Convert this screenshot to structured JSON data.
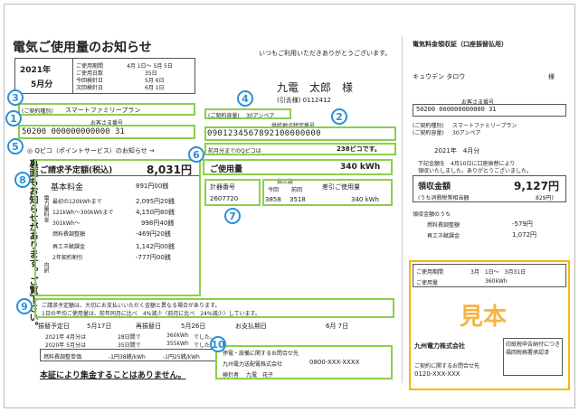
{
  "title": "電気ご使用量のお知らせ",
  "greeting": "いつもご利用いただきありがとうございます。",
  "period": {
    "year": "2021年",
    "month": "5月分",
    "label_usage_period": "ご使用期間",
    "usage_period": "4月 1日～ 5月 5日",
    "label_usage_days": "ご使用日数",
    "usage_days": "35日",
    "label_this_meter": "今回検針日",
    "this_meter": "5月 6日",
    "label_next_meter": "次回検針日",
    "next_meter": "6月 1日"
  },
  "customer": {
    "name": "九電　太郎　様",
    "code": "(引去様) 0112412",
    "contract_type_label": "(ご契約種別)",
    "contract_type": "スマートファミリープラン",
    "number_label": "お客さま番号",
    "number": "50200 000000000000 31",
    "capacity_label": "(ご契約容量)",
    "capacity": "30アンペア",
    "supply_point_label": "供給地点特定番号",
    "supply_point": "0901234567892100000000"
  },
  "points": {
    "label": "◎ Qピコ（ポイントサービス）のお知らせ →",
    "prev_label": "前月分までのQピコは",
    "value": "238ピコです。"
  },
  "amount": {
    "label": "ご請求予定額(税込)",
    "value": "8,031円",
    "usage_label": "ご使用量",
    "usage_value": "340 kWh"
  },
  "breakdown": {
    "base_label": "基本料金",
    "base_value": "891円00銭",
    "side_label": "電力量料金",
    "items": [
      {
        "label": "最初の120kWhまで",
        "value": "2,095円20銭"
      },
      {
        "label": "121kWh～300kWhまで",
        "value": "4,150円80銭"
      },
      {
        "label": "301kWh～",
        "value": "998円40銭"
      },
      {
        "label": "燃料費調整額",
        "value": "-469円20銭"
      },
      {
        "label": "再エネ賦課金",
        "value": "1,142円00銭"
      },
      {
        "label": "2年契約割引",
        "value": "-777円00銭"
      }
    ],
    "detail_label": "内訳"
  },
  "meter": {
    "label": "計器番号",
    "number": "2607720",
    "reading_label": "指示数",
    "this_label": "今回",
    "prev_label": "前回",
    "this": "3858",
    "prev": "3518",
    "diff_label": "差引ご使用量",
    "diff": "340 kWh"
  },
  "notes": {
    "line1": "ご請求予定額は、大切にお支払いいただく金額と異なる場合があります。",
    "line2": "1日の平均ご使用量は、前年同月に比べ　4%減少（前月に比べ　24%減少）しています。"
  },
  "history": {
    "due_label": "振替予定日",
    "due": "5月17日",
    "retry_label": "再振替日",
    "retry": "5月26日",
    "pay_label": "お支払期日",
    "pay": "6月 7日",
    "rows": [
      {
        "label": "2021年 4月分は",
        "days": "28日間で",
        "kwh": "360kWh",
        "note": "でした。"
      },
      {
        "label": "2020年 5月分は",
        "days": "35日間で",
        "kwh": "355kWh",
        "note": "でした。"
      }
    ],
    "fuel_label": "燃料費調整単価",
    "fuel_this": "-1円38銭/kWh",
    "fuel_next": "-1円25銭/kWh"
  },
  "footer_notice": "本証により集金することはありません。",
  "contact": {
    "title": "停電・設備に関するお問合せ先",
    "company": "九州電力送配電株式会社",
    "phone": "0800-XXX-XXXX",
    "meter_reader_label": "検針者",
    "meter_reader": "九電　花子"
  },
  "receipt": {
    "title": "電気料金領収証（口座振替払用）",
    "name": "キュウデン タロウ",
    "sama": "様",
    "number_label": "お客さま番号",
    "number": "50200 000000000000 31",
    "contract_type_label": "(ご契約種別)",
    "contract_type": "スマートファミリープラン",
    "capacity_label": "(ご契約容量)",
    "capacity": "30アンペア",
    "period": "2021年　4月分",
    "note1": "下記金額を　4月10日に口座振替により",
    "note2": "領収いたしました。ありがとうございました。",
    "amount_label": "領収金額",
    "amount": "9,127円",
    "tax_label": "(うち消費税等相当額",
    "tax": "829円)",
    "breakdown_label": "領収金額のうち",
    "fuel_label": "燃料費調整額",
    "fuel": "-579円",
    "renew_label": "再エネ賦課金",
    "renew": "1,072円",
    "usage_period_label": "ご使用期間",
    "usage_period": "3月　1日～　3月31日",
    "usage_label": "ご使用量",
    "usage": "360kWh",
    "stamp": "見本",
    "company": "九州電力株式会社",
    "inquiry_label": "ご契約に関するお問合せ先",
    "inquiry_phone": "0120-XXX-XXX",
    "tax_stamp": "印紙税申告納付につき福岡税務署承認済"
  }
}
